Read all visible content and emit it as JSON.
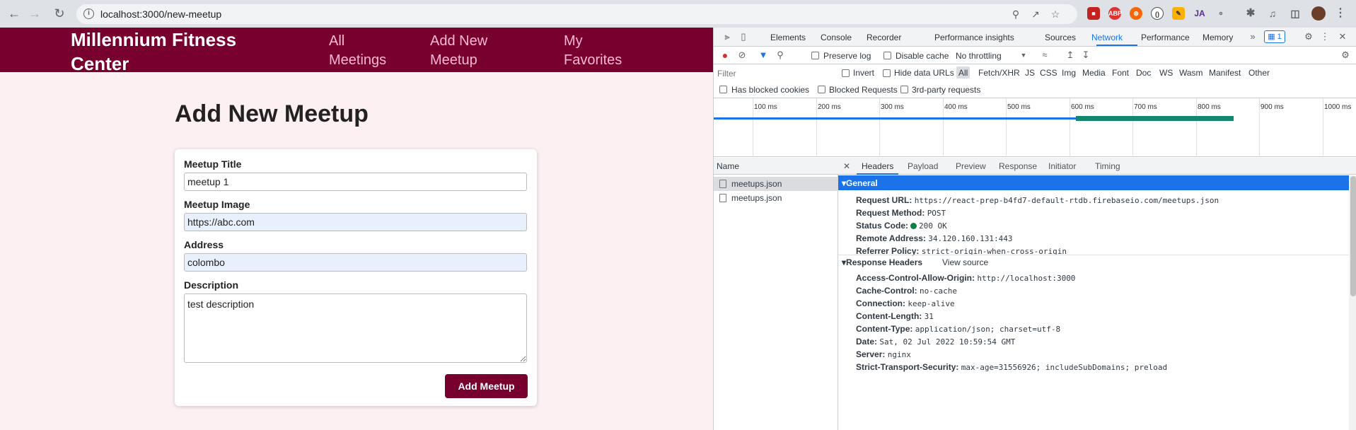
{
  "browser": {
    "url": "localhost:3000/new-meetup",
    "extensions": [
      "abp-icon",
      "ja-icon"
    ],
    "ext_labels": {
      "abp": "ABP",
      "ja": "JA"
    }
  },
  "app": {
    "brand": "Millennium Fitness Center",
    "nav": [
      "All Meetings",
      "Add New Meetup",
      "My Favorites"
    ],
    "heading": "Add New Meetup",
    "form": {
      "title_label": "Meetup Title",
      "title_value": "meetup 1",
      "image_label": "Meetup Image",
      "image_value": "https://abc.com",
      "address_label": "Address",
      "address_value": "colombo",
      "description_label": "Description",
      "description_value": "test description",
      "submit_label": "Add Meetup"
    }
  },
  "devtools": {
    "tabs": [
      "Elements",
      "Console",
      "Recorder",
      "Performance insights",
      "Sources",
      "Network",
      "Performance",
      "Memory"
    ],
    "active_tab": "Network",
    "issues_count": "1",
    "toolbar": {
      "preserve_log": "Preserve log",
      "disable_cache": "Disable cache",
      "throttling": "No throttling"
    },
    "filter": {
      "placeholder": "Filter",
      "invert": "Invert",
      "hide_data_urls": "Hide data URLs",
      "types": [
        "All",
        "Fetch/XHR",
        "JS",
        "CSS",
        "Img",
        "Media",
        "Font",
        "Doc",
        "WS",
        "Wasm",
        "Manifest",
        "Other"
      ],
      "has_blocked_cookies": "Has blocked cookies",
      "blocked_requests": "Blocked Requests",
      "third_party": "3rd-party requests"
    },
    "timeline_ticks": [
      "100 ms",
      "200 ms",
      "300 ms",
      "400 ms",
      "500 ms",
      "600 ms",
      "700 ms",
      "800 ms",
      "900 ms",
      "1000 ms"
    ],
    "name_header": "Name",
    "requests": [
      "meetups.json",
      "meetups.json"
    ],
    "detail_tabs": [
      "Headers",
      "Payload",
      "Preview",
      "Response",
      "Initiator",
      "Timing"
    ],
    "general": {
      "title": "General",
      "rows": [
        {
          "k": "Request URL:",
          "v": "https://react-prep-b4fd7-default-rtdb.firebaseio.com/meetups.json"
        },
        {
          "k": "Request Method:",
          "v": "POST"
        },
        {
          "k": "Status Code:",
          "v": "200 OK"
        },
        {
          "k": "Remote Address:",
          "v": "34.120.160.131:443"
        },
        {
          "k": "Referrer Policy:",
          "v": "strict-origin-when-cross-origin"
        }
      ]
    },
    "response_headers": {
      "title": "Response Headers",
      "view_source": "View source",
      "rows": [
        {
          "k": "Access-Control-Allow-Origin:",
          "v": "http://localhost:3000"
        },
        {
          "k": "Cache-Control:",
          "v": "no-cache"
        },
        {
          "k": "Connection:",
          "v": "keep-alive"
        },
        {
          "k": "Content-Length:",
          "v": "31"
        },
        {
          "k": "Content-Type:",
          "v": "application/json; charset=utf-8"
        },
        {
          "k": "Date:",
          "v": "Sat, 02 Jul 2022 10:59:54 GMT"
        },
        {
          "k": "Server:",
          "v": "nginx"
        },
        {
          "k": "Strict-Transport-Security:",
          "v": "max-age=31556926; includeSubDomains; preload"
        }
      ]
    }
  }
}
